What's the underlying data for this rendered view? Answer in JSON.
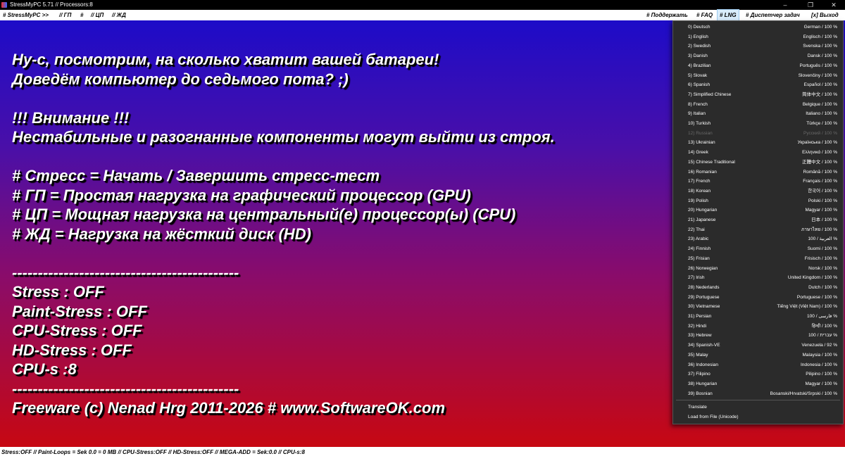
{
  "window": {
    "title": "StressMyPC 5.71 // Processors:8",
    "controls": [
      "–",
      "❐",
      "✕"
    ]
  },
  "menubar": {
    "left": [
      "# StressMyPC >>",
      "// ГП",
      "#",
      "// ЦП",
      "// ЖД"
    ],
    "right": [
      "# Поддержать",
      "# FAQ",
      "# LNG",
      "# Диспетчер задач",
      "[x] Выход"
    ]
  },
  "main": {
    "lines": [
      "Ну-с, посмотрим, на сколько хватит вашей батареи!",
      "Доведём компьютер до седьмого пота? ;)",
      "",
      "!!! Внимание !!!",
      "Нестабильные и разогнанные компоненты могут выйти из строя.",
      "",
      "# Стресс = Начать / Завершить стресс-тест",
      "# ГП = Простая нагрузка на графический процессор (GPU)",
      "# ЦП = Мощная нагрузка на центральный(е) процессор(ы) (CPU)",
      "# ЖД = Нагрузка на жёсткий диск (HD)",
      "",
      "--------------------------------------------",
      "Stress : OFF",
      "Paint-Stress : OFF",
      "CPU-Stress : OFF",
      "HD-Stress : OFF",
      "CPU-s :8",
      "--------------------------------------------",
      "Freeware (c) Nenad Hrg 2011-2026 # www.SoftwareOK.com"
    ]
  },
  "lang_menu": {
    "items": [
      {
        "name": "0) Deutsch",
        "native": "German / 100 %"
      },
      {
        "name": "1) English",
        "native": "Englisch / 100 %"
      },
      {
        "name": "2) Swedish",
        "native": "Svenska / 100 %"
      },
      {
        "name": "3) Danish",
        "native": "Dansk / 100 %"
      },
      {
        "name": "4) Brazilian",
        "native": "Português / 100 %"
      },
      {
        "name": "5) Slovak",
        "native": "Slovenčiny / 100 %"
      },
      {
        "name": "6) Spanish",
        "native": "Español / 100 %"
      },
      {
        "name": "7) Simplified Chinese",
        "native": "简体中文 / 100 %"
      },
      {
        "name": "8) French",
        "native": "Belgique / 100 %"
      },
      {
        "name": "9) Italian",
        "native": "Italiano / 100 %"
      },
      {
        "name": "10) Turkish",
        "native": "Türkçe / 100 %"
      },
      {
        "name": "12) Russian",
        "native": "Русский / 100 %",
        "disabled": true
      },
      {
        "name": "13) Ukrainian",
        "native": "Українська / 100 %"
      },
      {
        "name": "14) Greek",
        "native": "Ελληνικά / 100 %"
      },
      {
        "name": "15) Chinese Traditional",
        "native": "正體中文 / 100 %"
      },
      {
        "name": "16) Romanian",
        "native": "Română / 100 %"
      },
      {
        "name": "17) French",
        "native": "Français / 100 %"
      },
      {
        "name": "18) Korean",
        "native": "한국어 / 100 %"
      },
      {
        "name": "19) Polish",
        "native": "Polski / 100 %"
      },
      {
        "name": "20) Hungarian",
        "native": "Magyar / 100 %"
      },
      {
        "name": "21) Japanese",
        "native": "日本 / 100 %"
      },
      {
        "name": "22) Thai",
        "native": "ภาษาไทย / 100 %"
      },
      {
        "name": "23) Arabic",
        "native": "100 / العربية %"
      },
      {
        "name": "24) Finnish",
        "native": "Suomi / 100 %"
      },
      {
        "name": "25) Frisian",
        "native": "Frisisch / 100 %"
      },
      {
        "name": "26) Norwegian",
        "native": "Norsk / 100 %"
      },
      {
        "name": "27) Irish",
        "native": "United Kingdom / 100 %"
      },
      {
        "name": "28) Nederlands",
        "native": "Dutch / 100 %"
      },
      {
        "name": "29) Portuguese",
        "native": "Portuguese / 100 %"
      },
      {
        "name": "30) Vietnamese",
        "native": "Tiếng Việt (Việt Nam) / 100 %"
      },
      {
        "name": "31) Persian",
        "native": "100 / فارسی %"
      },
      {
        "name": "32) Hindi",
        "native": "हिन्दी / 100 %"
      },
      {
        "name": "33) Hebrew",
        "native": "100 / עברית %"
      },
      {
        "name": "34) Spanish-VE",
        "native": "Venezuela / 92 %"
      },
      {
        "name": "35) Malay",
        "native": "Malaysia / 100 %"
      },
      {
        "name": "36) Indonesian",
        "native": "Indonesia / 100 %"
      },
      {
        "name": "37) Filipino",
        "native": "Pilipino / 100 %"
      },
      {
        "name": "38) Hungarian",
        "native": "Magyar / 100 %"
      },
      {
        "name": "39) Bosnian",
        "native": "Bosanski/Hrvatski/Srpski / 100 %"
      }
    ],
    "actions": [
      "Translate",
      "Load from File (Unicode)"
    ]
  },
  "statusbar": {
    "text": "Stress:OFF // Paint-Loops = Sek 0.0 = 0 MB // CPU-Stress:OFF // HD-Stress:OFF // MEGA-ADD = Sek:0.0 // CPU-s:8"
  },
  "colors": {
    "gradient_top": "#1d0cc8",
    "gradient_bottom": "#c70812",
    "menu_bg": "#2b2b2b",
    "active_menu_bg": "#d8ecfb"
  }
}
